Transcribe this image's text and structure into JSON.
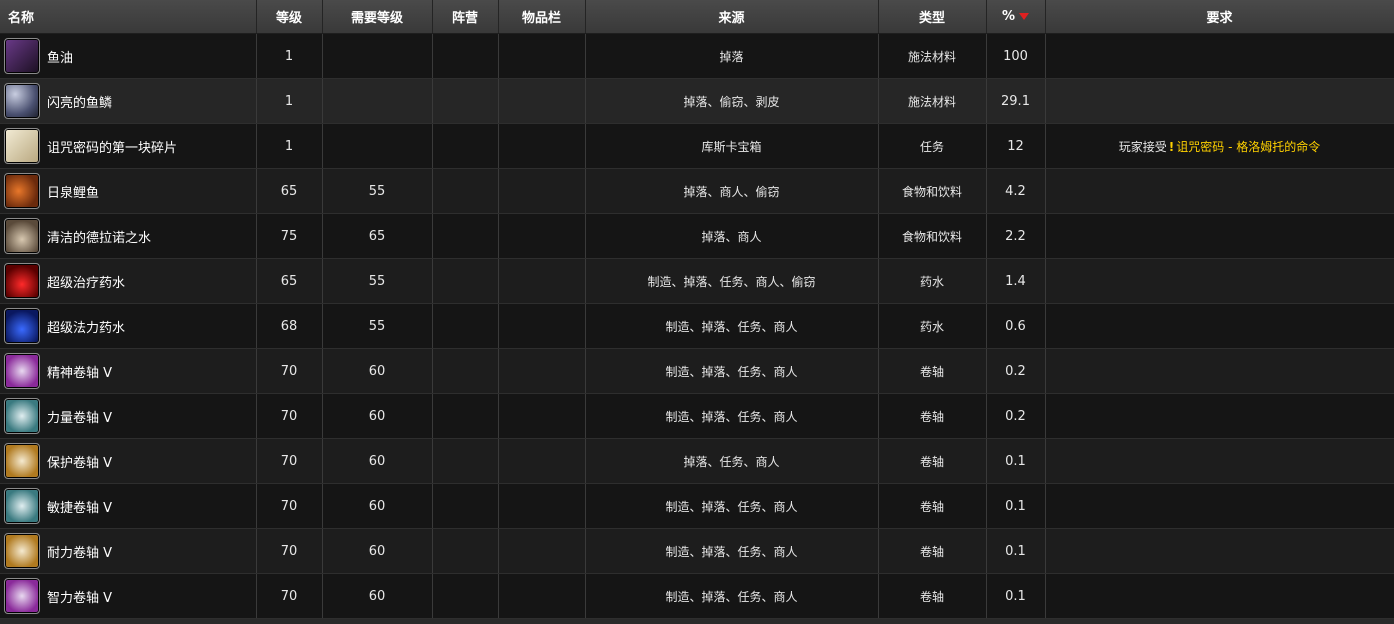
{
  "headers": {
    "name": "名称",
    "level": "等级",
    "req_level": "需要等级",
    "faction": "阵营",
    "slot": "物品栏",
    "source": "来源",
    "type": "类型",
    "percent": "%",
    "requirements": "要求"
  },
  "sort": {
    "column": "percent",
    "direction": "desc"
  },
  "rows": [
    {
      "name": "鱼油",
      "icon": "fish-oil-vial-icon",
      "level": "1",
      "req_level": "",
      "faction": "",
      "slot": "",
      "source": "掉落",
      "type": "施法材料",
      "percent": "100",
      "req_prefix": "",
      "req_quest": ""
    },
    {
      "name": "闪亮的鱼鳞",
      "icon": "fish-scales-icon",
      "level": "1",
      "req_level": "",
      "faction": "",
      "slot": "",
      "source": "掉落、偷窃、剥皮",
      "type": "施法材料",
      "percent": "29.1",
      "req_prefix": "",
      "req_quest": ""
    },
    {
      "name": "诅咒密码的第一块碎片",
      "icon": "parchment-fragment-icon",
      "level": "1",
      "req_level": "",
      "faction": "",
      "slot": "",
      "source": "库斯卡宝箱",
      "type": "任务",
      "percent": "12",
      "req_prefix": "玩家接受",
      "req_quest": "诅咒密码 - 格洛姆托的命令"
    },
    {
      "name": "日泉鲤鱼",
      "icon": "sunspring-carp-icon",
      "level": "65",
      "req_level": "55",
      "faction": "",
      "slot": "",
      "source": "掉落、商人、偷窃",
      "type": "食物和饮料",
      "percent": "4.2",
      "req_prefix": "",
      "req_quest": ""
    },
    {
      "name": "清洁的德拉诺之水",
      "icon": "water-flask-icon",
      "level": "75",
      "req_level": "65",
      "faction": "",
      "slot": "",
      "source": "掉落、商人",
      "type": "食物和饮料",
      "percent": "2.2",
      "req_prefix": "",
      "req_quest": ""
    },
    {
      "name": "超级治疗药水",
      "icon": "red-potion-icon",
      "level": "65",
      "req_level": "55",
      "faction": "",
      "slot": "",
      "source": "制造、掉落、任务、商人、偷窃",
      "type": "药水",
      "percent": "1.4",
      "req_prefix": "",
      "req_quest": ""
    },
    {
      "name": "超级法力药水",
      "icon": "blue-potion-icon",
      "level": "68",
      "req_level": "55",
      "faction": "",
      "slot": "",
      "source": "制造、掉落、任务、商人",
      "type": "药水",
      "percent": "0.6",
      "req_prefix": "",
      "req_quest": ""
    },
    {
      "name": "精神卷轴 V",
      "icon": "purple-scroll-icon",
      "level": "70",
      "req_level": "60",
      "faction": "",
      "slot": "",
      "source": "制造、掉落、任务、商人",
      "type": "卷轴",
      "percent": "0.2",
      "req_prefix": "",
      "req_quest": ""
    },
    {
      "name": "力量卷轴 V",
      "icon": "teal-scroll-icon",
      "level": "70",
      "req_level": "60",
      "faction": "",
      "slot": "",
      "source": "制造、掉落、任务、商人",
      "type": "卷轴",
      "percent": "0.2",
      "req_prefix": "",
      "req_quest": ""
    },
    {
      "name": "保护卷轴 V",
      "icon": "gold-scroll-icon",
      "level": "70",
      "req_level": "60",
      "faction": "",
      "slot": "",
      "source": "掉落、任务、商人",
      "type": "卷轴",
      "percent": "0.1",
      "req_prefix": "",
      "req_quest": ""
    },
    {
      "name": "敏捷卷轴 V",
      "icon": "teal-scroll-icon",
      "level": "70",
      "req_level": "60",
      "faction": "",
      "slot": "",
      "source": "制造、掉落、任务、商人",
      "type": "卷轴",
      "percent": "0.1",
      "req_prefix": "",
      "req_quest": ""
    },
    {
      "name": "耐力卷轴 V",
      "icon": "gold-scroll-icon",
      "level": "70",
      "req_level": "60",
      "faction": "",
      "slot": "",
      "source": "制造、掉落、任务、商人",
      "type": "卷轴",
      "percent": "0.1",
      "req_prefix": "",
      "req_quest": ""
    },
    {
      "name": "智力卷轴 V",
      "icon": "purple-scroll-icon",
      "level": "70",
      "req_level": "60",
      "faction": "",
      "slot": "",
      "source": "制造、掉落、任务、商人",
      "type": "卷轴",
      "percent": "0.1",
      "req_prefix": "",
      "req_quest": ""
    }
  ],
  "colors": {
    "quest_link": "#ffd100",
    "sort_arrow": "#e02020",
    "header_bg": "#424242",
    "row_bg": "#151515"
  }
}
